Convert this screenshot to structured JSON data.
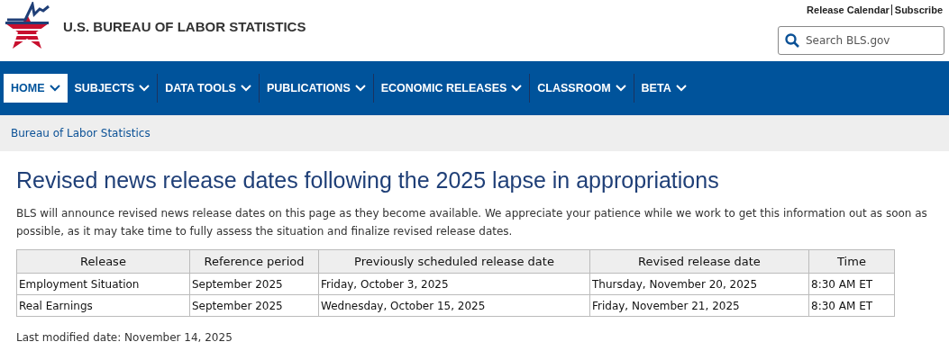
{
  "header": {
    "agency": "U.S. BUREAU OF LABOR STATISTICS",
    "links": [
      "Release Calendar",
      "Subscribe"
    ],
    "search": {
      "placeholder": "Search BLS.gov"
    }
  },
  "nav": [
    {
      "label": "HOME",
      "selected": true
    },
    {
      "label": "SUBJECTS",
      "selected": false
    },
    {
      "label": "DATA TOOLS",
      "selected": false
    },
    {
      "label": "PUBLICATIONS",
      "selected": false
    },
    {
      "label": "ECONOMIC RELEASES",
      "selected": false
    },
    {
      "label": "CLASSROOM",
      "selected": false
    },
    {
      "label": "BETA",
      "selected": false
    }
  ],
  "breadcrumb": "Bureau of Labor Statistics",
  "title": "Revised news release dates following the 2025 lapse in appropriations",
  "intro": "BLS will announce revised news release dates on this page as they become available. We appreciate your patience while we work to get this information out as soon as possible, as it may take time to fully assess the situation and finalize revised release dates.",
  "table": {
    "columns": [
      "Release",
      "Reference period",
      "Previously scheduled release date",
      "Revised release date",
      "Time"
    ],
    "rows": [
      [
        "Employment Situation",
        "September 2025",
        "Friday, October 3, 2025",
        "Thursday, November 20, 2025",
        "8:30 AM ET"
      ],
      [
        "Real Earnings",
        "September 2025",
        "Wednesday, October 15, 2025",
        "Friday, November 21, 2025",
        "8:30 AM ET"
      ]
    ]
  },
  "last_modified": "Last modified date: November 14, 2025"
}
